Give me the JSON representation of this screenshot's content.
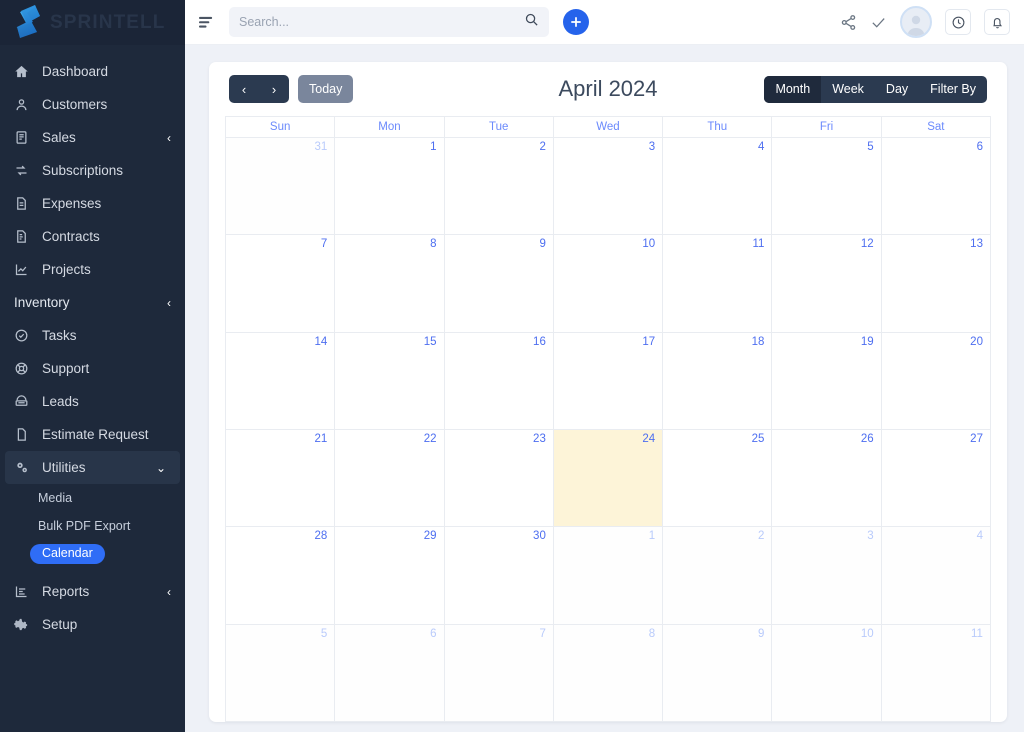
{
  "brand": {
    "name": "SPRINTELL",
    "logo_icon": "sprintell-ribbon-logo"
  },
  "sidebar": {
    "items": [
      {
        "label": "Dashboard",
        "icon": "home-icon",
        "chevron": ""
      },
      {
        "label": "Customers",
        "icon": "user-icon",
        "chevron": ""
      },
      {
        "label": "Sales",
        "icon": "receipt-icon",
        "chevron": "‹"
      },
      {
        "label": "Subscriptions",
        "icon": "refresh-icon",
        "chevron": ""
      },
      {
        "label": "Expenses",
        "icon": "file-icon",
        "chevron": ""
      },
      {
        "label": "Contracts",
        "icon": "contract-icon",
        "chevron": ""
      },
      {
        "label": "Projects",
        "icon": "chart-icon",
        "chevron": ""
      },
      {
        "label": "Inventory",
        "icon": "",
        "chevron": "‹"
      },
      {
        "label": "Tasks",
        "icon": "check-circle-icon",
        "chevron": ""
      },
      {
        "label": "Support",
        "icon": "lifebuoy-icon",
        "chevron": ""
      },
      {
        "label": "Leads",
        "icon": "leads-icon",
        "chevron": ""
      },
      {
        "label": "Estimate Request",
        "icon": "document-icon",
        "chevron": ""
      },
      {
        "label": "Utilities",
        "icon": "gears-icon",
        "chevron": "⌄"
      }
    ],
    "sub_items": [
      {
        "label": "Media",
        "active": false
      },
      {
        "label": "Bulk PDF Export",
        "active": false
      },
      {
        "label": "Calendar",
        "active": true
      }
    ],
    "items_after": [
      {
        "label": "Reports",
        "icon": "bar-chart-icon",
        "chevron": "‹"
      },
      {
        "label": "Setup",
        "icon": "gear-icon",
        "chevron": ""
      }
    ],
    "active_item": "Utilities",
    "active_sub": "Calendar",
    "active_pill_color": "#2f6df6",
    "background_color": "#1e293b"
  },
  "topbar": {
    "menu_icon": "hamburger-icon",
    "search": {
      "placeholder": "Search...",
      "value": "",
      "icon": "search-icon"
    },
    "add_button": {
      "label": "+",
      "icon": "plus-icon",
      "color": "#2563eb"
    },
    "right_icons": [
      "share-icon",
      "check-icon",
      "avatar",
      "clock-icon",
      "bell-icon"
    ]
  },
  "calendar": {
    "title": "April 2024",
    "prev_label": "‹",
    "next_label": "›",
    "today_label": "Today",
    "views": [
      {
        "label": "Month",
        "active": true
      },
      {
        "label": "Week",
        "active": false
      },
      {
        "label": "Day",
        "active": false
      },
      {
        "label": "Filter By",
        "active": false
      }
    ],
    "day_headers": [
      "Sun",
      "Mon",
      "Tue",
      "Wed",
      "Thu",
      "Fri",
      "Sat"
    ],
    "today_date": 24,
    "today_highlight_color": "#fdf4d8",
    "weeks": [
      [
        {
          "n": "31",
          "other": true
        },
        {
          "n": "1"
        },
        {
          "n": "2"
        },
        {
          "n": "3"
        },
        {
          "n": "4"
        },
        {
          "n": "5"
        },
        {
          "n": "6"
        }
      ],
      [
        {
          "n": "7"
        },
        {
          "n": "8"
        },
        {
          "n": "9"
        },
        {
          "n": "10"
        },
        {
          "n": "11"
        },
        {
          "n": "12"
        },
        {
          "n": "13"
        }
      ],
      [
        {
          "n": "14"
        },
        {
          "n": "15"
        },
        {
          "n": "16"
        },
        {
          "n": "17"
        },
        {
          "n": "18"
        },
        {
          "n": "19"
        },
        {
          "n": "20"
        }
      ],
      [
        {
          "n": "21"
        },
        {
          "n": "22"
        },
        {
          "n": "23"
        },
        {
          "n": "24",
          "today": true
        },
        {
          "n": "25"
        },
        {
          "n": "26"
        },
        {
          "n": "27"
        }
      ],
      [
        {
          "n": "28"
        },
        {
          "n": "29"
        },
        {
          "n": "30"
        },
        {
          "n": "1",
          "other": true
        },
        {
          "n": "2",
          "other": true
        },
        {
          "n": "3",
          "other": true
        },
        {
          "n": "4",
          "other": true
        }
      ],
      [
        {
          "n": "5",
          "other": true
        },
        {
          "n": "6",
          "other": true
        },
        {
          "n": "7",
          "other": true
        },
        {
          "n": "8",
          "other": true
        },
        {
          "n": "9",
          "other": true
        },
        {
          "n": "10",
          "other": true
        },
        {
          "n": "11",
          "other": true
        }
      ]
    ]
  }
}
